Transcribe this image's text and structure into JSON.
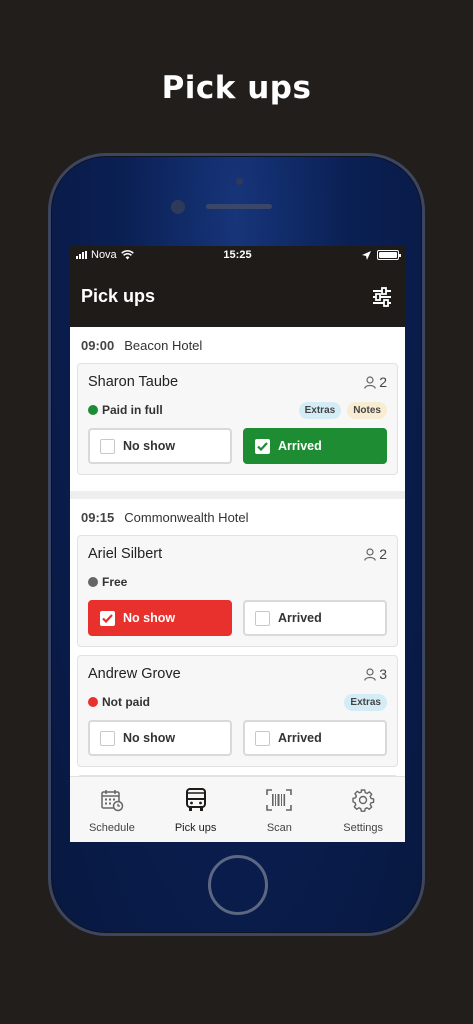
{
  "promo": {
    "title": "Pick ups"
  },
  "status_bar": {
    "carrier": "Nova",
    "time": "15:25"
  },
  "app_bar": {
    "title": "Pick ups",
    "filter_icon": "sliders-icon"
  },
  "groups": [
    {
      "time": "09:00",
      "hotel": "Beacon Hotel",
      "bookings": [
        {
          "name": "Sharon Taube",
          "pax": "2",
          "status": "Paid in full",
          "status_color": "#1d8c33",
          "tags": [
            "Extras",
            "Notes"
          ],
          "no_show_label": "No show",
          "arrived_label": "Arrived",
          "state": "arrived"
        }
      ]
    },
    {
      "time": "09:15",
      "hotel": "Commonwealth Hotel",
      "bookings": [
        {
          "name": "Ariel Silbert",
          "pax": "2",
          "status": "Free",
          "status_color": "#666666",
          "tags": [],
          "no_show_label": "No show",
          "arrived_label": "Arrived",
          "state": "no_show"
        },
        {
          "name": "Andrew Grove",
          "pax": "3",
          "status": "Not paid",
          "status_color": "#e8312c",
          "tags": [
            "Extras"
          ],
          "no_show_label": "No show",
          "arrived_label": "Arrived",
          "state": "none"
        }
      ]
    }
  ],
  "tabs": [
    {
      "label": "Schedule",
      "icon": "calendar-clock-icon",
      "active": false
    },
    {
      "label": "Pick ups",
      "icon": "bus-icon",
      "active": true
    },
    {
      "label": "Scan",
      "icon": "barcode-scan-icon",
      "active": false
    },
    {
      "label": "Settings",
      "icon": "gear-icon",
      "active": false
    }
  ],
  "colors": {
    "accent_green": "#1d8c33",
    "accent_red": "#e8312c",
    "extras_tag": "#d3ecf6",
    "notes_tag": "#f8ecd2"
  }
}
